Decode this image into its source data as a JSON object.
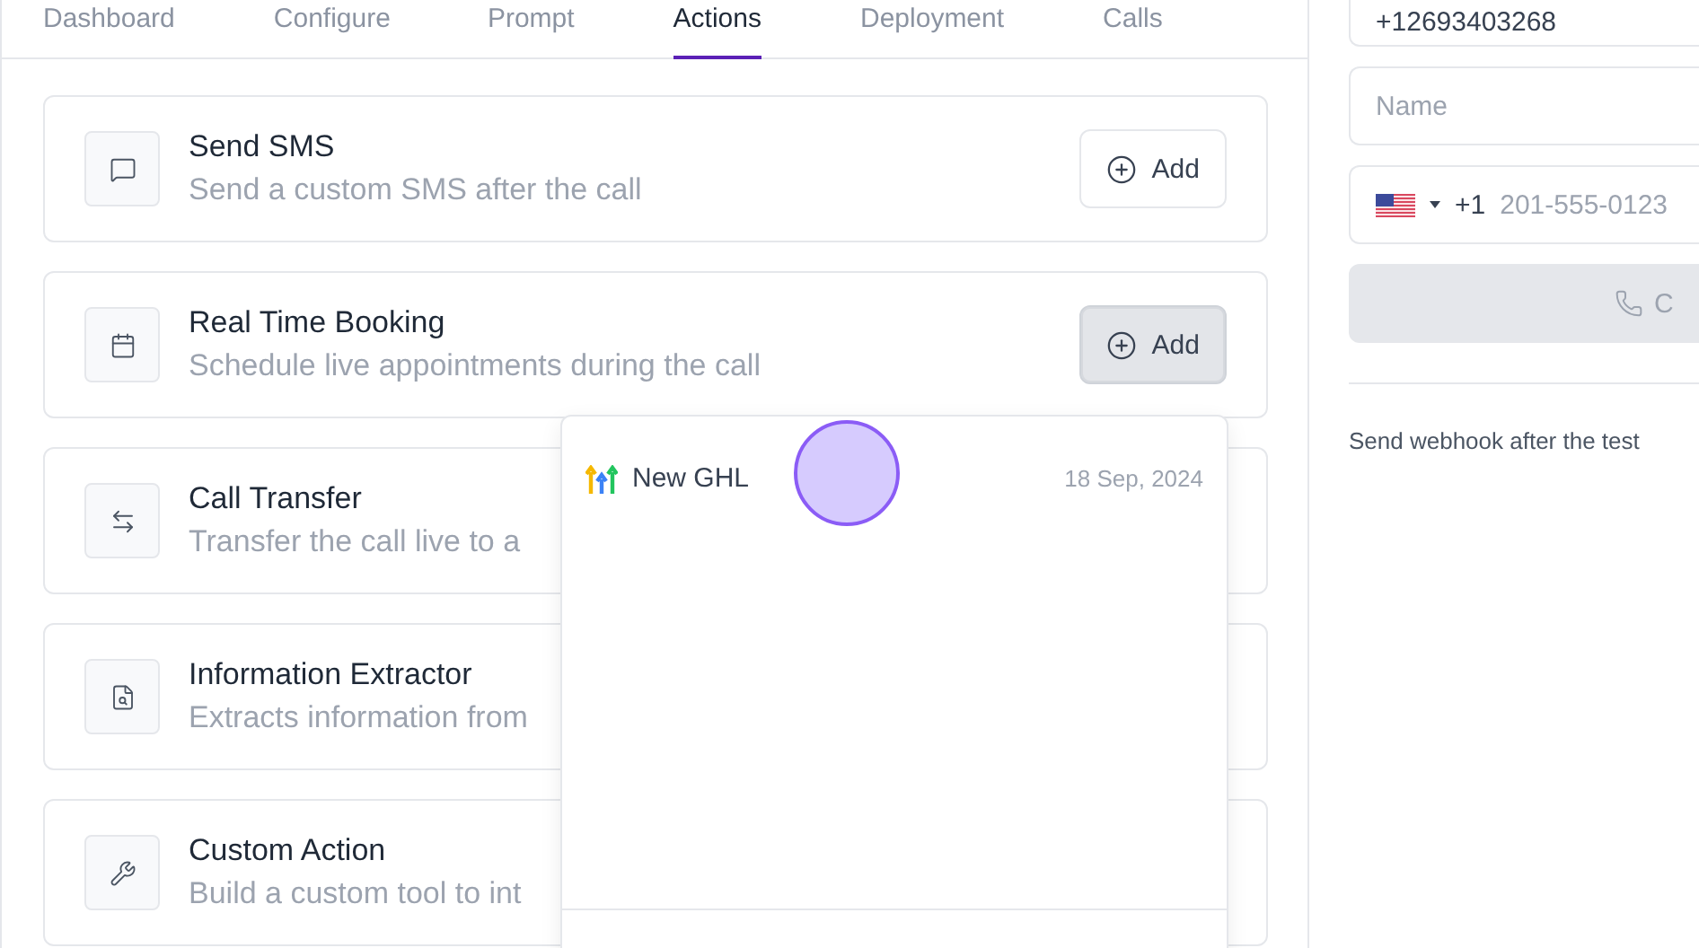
{
  "tabs": [
    {
      "label": "Dashboard",
      "selected": false
    },
    {
      "label": "Configure",
      "selected": false
    },
    {
      "label": "Prompt",
      "selected": false
    },
    {
      "label": "Actions",
      "selected": true
    },
    {
      "label": "Deployment",
      "selected": false
    },
    {
      "label": "Calls",
      "selected": false
    }
  ],
  "actions": [
    {
      "kind": "sms",
      "title": "Send SMS",
      "description": "Send a custom SMS after the call",
      "button": "Add",
      "highlighted": false
    },
    {
      "kind": "booking",
      "title": "Real Time Booking",
      "description": "Schedule live appointments during the call",
      "button": "Add",
      "highlighted": true
    },
    {
      "kind": "transfer",
      "title": "Call Transfer",
      "description": "Transfer the call live to a"
    },
    {
      "kind": "extractor",
      "title": "Information Extractor",
      "description": "Extracts information from"
    },
    {
      "kind": "custom",
      "title": "Custom Action",
      "description": "Build a custom tool to int"
    }
  ],
  "dropdown": {
    "items": [
      {
        "name": "New GHL",
        "date": "18 Sep, 2024"
      }
    ]
  },
  "test_call": {
    "from_value": "+12693403268",
    "name_placeholder": "Name",
    "country_code": "+1",
    "phone_placeholder": "201-555-0123",
    "call_button": "C",
    "call_disabled": true,
    "webhook_label": "Send webhook after the test"
  }
}
